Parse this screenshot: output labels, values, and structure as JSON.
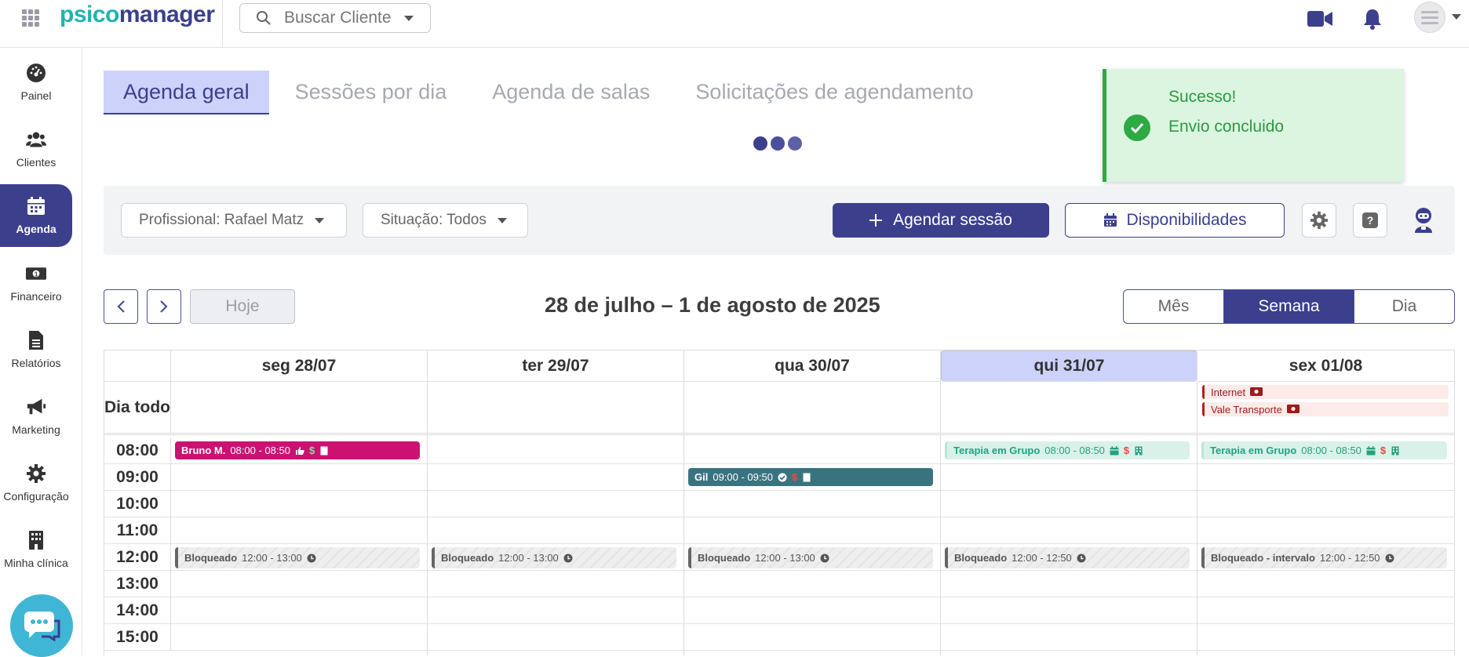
{
  "header": {
    "logo_part1": "psico",
    "logo_part2": "manager",
    "search_placeholder": "Buscar Cliente"
  },
  "sidebar": {
    "items": [
      {
        "label": "Painel",
        "icon": "gauge-icon"
      },
      {
        "label": "Clientes",
        "icon": "users-icon"
      },
      {
        "label": "Agenda",
        "icon": "calendar-icon",
        "active": true
      },
      {
        "label": "Financeiro",
        "icon": "money-icon"
      },
      {
        "label": "Relatórios",
        "icon": "file-icon"
      },
      {
        "label": "Marketing",
        "icon": "megaphone-icon"
      },
      {
        "label": "Configuração",
        "icon": "gear-icon"
      },
      {
        "label": "Minha clínica",
        "icon": "building-icon"
      }
    ]
  },
  "tabs": [
    {
      "label": "Agenda geral",
      "active": true
    },
    {
      "label": "Sessões por dia"
    },
    {
      "label": "Agenda de salas"
    },
    {
      "label": "Solicitações de agendamento"
    }
  ],
  "toast": {
    "title": "Sucesso!",
    "message": "Envio concluido",
    "color": "#2eaa43"
  },
  "filters": {
    "professional": "Profissional: Rafael Matz",
    "status": "Situação: Todos",
    "schedule_button": "Agendar sessão",
    "availability_button": "Disponibilidades"
  },
  "calendar_nav": {
    "today": "Hoje",
    "range_title": "28 de julho – 1 de agosto de 2025",
    "views": [
      "Mês",
      "Semana",
      "Dia"
    ],
    "active_view": "Semana"
  },
  "calendar": {
    "all_day_label": "Dia todo",
    "days": [
      "seg 28/07",
      "ter 29/07",
      "qua 30/07",
      "qui 31/07",
      "sex 01/08"
    ],
    "today_index": 3,
    "hours": [
      "08:00",
      "09:00",
      "10:00",
      "11:00",
      "12:00",
      "13:00",
      "14:00",
      "15:00"
    ],
    "all_day_events": [
      {
        "day": 4,
        "label": "Internet"
      },
      {
        "day": 4,
        "label": "Vale Transporte"
      }
    ],
    "events": [
      {
        "day": 0,
        "name": "Bruno M.",
        "time": "08:00 - 08:50",
        "style": "bruno"
      },
      {
        "day": 2,
        "name": "Gil",
        "time": "09:00 - 09:50",
        "style": "gil"
      },
      {
        "day": 3,
        "name": "Terapia em Grupo",
        "time": "08:00 - 08:50",
        "style": "grupo"
      },
      {
        "day": 4,
        "name": "Terapia em Grupo",
        "time": "08:00 - 08:50",
        "style": "grupo"
      },
      {
        "day": 0,
        "name": "Bloqueado",
        "time": "12:00 - 13:00",
        "style": "blk"
      },
      {
        "day": 1,
        "name": "Bloqueado",
        "time": "12:00 - 13:00",
        "style": "blk"
      },
      {
        "day": 2,
        "name": "Bloqueado",
        "time": "12:00 - 13:00",
        "style": "blk"
      },
      {
        "day": 3,
        "name": "Bloqueado",
        "time": "12:00 - 12:50",
        "style": "blk"
      },
      {
        "day": 4,
        "name": "Bloqueado - intervalo",
        "time": "12:00 - 12:50",
        "style": "blk"
      }
    ]
  },
  "colors": {
    "brand": "#3b3f8c",
    "brand_accent": "#20b3b0",
    "today_highlight": "#cdd2fb",
    "event_magenta": "#cc1173",
    "event_teal": "#3a7380",
    "event_group": "#23a27f"
  }
}
